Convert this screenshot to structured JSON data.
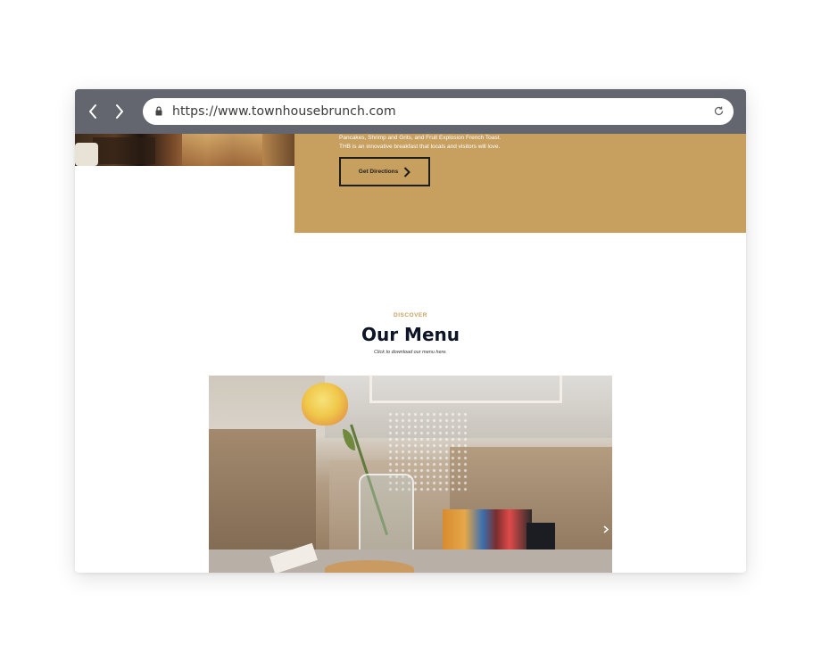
{
  "browser": {
    "url": "https://www.townhousebrunch.com",
    "icons": {
      "back": "chevron-left-icon",
      "forward": "chevron-right-icon",
      "lock": "lock-icon",
      "reload": "reload-icon"
    }
  },
  "info_panel": {
    "line1": "Pancakes, Shrimp and Grits, and Fruit Explosion French Toast.",
    "line2": "THB is an innovative breakfast that locals and visitors will love.",
    "directions_label": "Get Directions",
    "directions_icon": "chevron-right-icon",
    "panel_color": "#c7a060"
  },
  "menu_section": {
    "eyebrow": "DISCOVER",
    "title": "Our Menu",
    "subtitle": "Click to download our menu here.",
    "carousel_icon": "chevron-right-icon"
  },
  "colors": {
    "toolbar": "#63666f",
    "accent": "#c7a060",
    "title": "#0d1526"
  }
}
